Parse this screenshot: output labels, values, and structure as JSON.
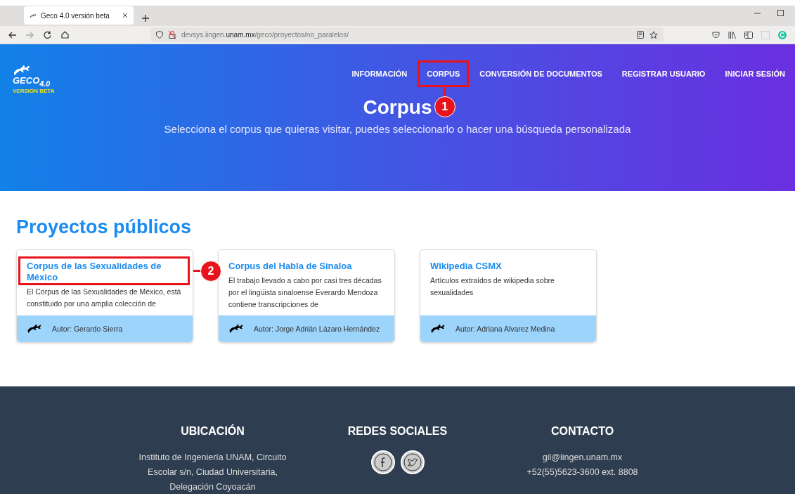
{
  "browser": {
    "tab_title": "Geco 4.0 versión beta",
    "url": "devsys.iingen.**unam.mx**/geco/proyectos/no_paralelos/"
  },
  "header": {
    "logo": "GECO$_{4.0}$",
    "logo_tag": "VERSIÓN BETA",
    "nav": [
      {
        "label": "INFORMACIÓN"
      },
      {
        "label": "CORPUS",
        "callout": "1"
      },
      {
        "label": "CONVERSIÓN DE DOCUMENTOS"
      },
      {
        "label": "REGISTRAR USUARIO"
      },
      {
        "label": "INICIAR SESIÓN"
      }
    ],
    "title": "Corpus",
    "subtitle": "Selecciona el corpus que quieras visitar, puedes seleccionarlo o hacer una búsqueda personalizada"
  },
  "section_title": "Proyectos públicos",
  "projects": [
    {
      "title": "Corpus de las Sexualidades de México",
      "description": "El Corpus de las Sexualidades de México, está constituido por una amplia colección de",
      "author": "Autor: Gerardo Sierra",
      "callout": "2"
    },
    {
      "title": "Corpus del Habla de Sinaloa",
      "description": "El trabajo llevado a cabo por casi tres décadas por el lingüista sinaloense Everardo Mendoza contiene transcripciones de",
      "author": "Autor: Jorge Adrián Lázaro Hernández"
    },
    {
      "title": "Wikipedia CSMX",
      "description": "Artículos extraídos de wikipedia sobre sexualidades",
      "author": "Autor: Adriana Alvarez Medina"
    }
  ],
  "footer": {
    "location": {
      "heading": "UBICACIÓN",
      "text": "Instituto de Ingeniería UNAM, Circuito Escolar s/n, Ciudad Universitaria, Delegación Coyoacán"
    },
    "social": {
      "heading": "REDES SOCIALES"
    },
    "contact": {
      "heading": "CONTACTO",
      "email": "gil@iingen.unam.mx",
      "phone": "+52(55)5623-3600 ext. 8808"
    }
  }
}
